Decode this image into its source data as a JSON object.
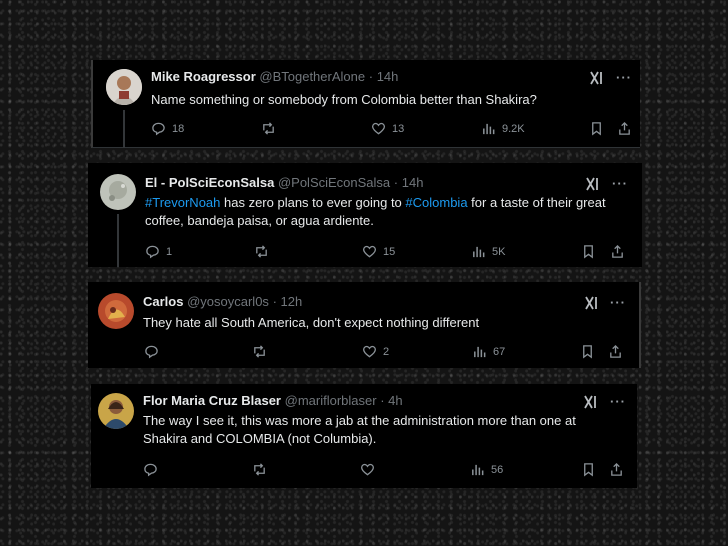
{
  "tweets": [
    {
      "name": "Mike Roagressor",
      "handle": "@BTogetherAlone",
      "separator": "·",
      "time": "14h",
      "text": "Name something or somebody from Colombia better than Shakira?",
      "stats": {
        "replies": "18",
        "reposts": "",
        "likes": "13",
        "views": "9.2K"
      },
      "avatar_color": "#c9c3bd"
    },
    {
      "name": "El - PolSciEconSalsa",
      "handle": "@PolSciEconSalsa",
      "separator": "·",
      "time": "14h",
      "text_parts": [
        "#TrevorNoah",
        " has zero plans to ever going to ",
        "#Colombia",
        " for a taste of their great coffee, bandeja paisa, or agua ardiente."
      ],
      "stats": {
        "replies": "1",
        "reposts": "",
        "likes": "15",
        "views": "5K"
      },
      "avatar_color": "#b9bdb4"
    },
    {
      "name": "Carlos",
      "handle": "@yosoycarl0s",
      "separator": "·",
      "time": "12h",
      "text": "They hate all South America, don't expect nothing different",
      "stats": {
        "replies": "",
        "reposts": "",
        "likes": "2",
        "views": "67"
      },
      "avatar_color": "#b5442a"
    },
    {
      "name": "Flor Maria Cruz Blaser",
      "handle": "@mariflorblaser",
      "separator": "·",
      "time": "4h",
      "text": "The way I see it, this was more a jab at the administration more than one at Shakira and COLOMBIA (not Columbia).",
      "stats": {
        "replies": "",
        "reposts": "",
        "likes": "",
        "views": "56"
      },
      "avatar_color": "#c9a548"
    }
  ],
  "ui": {
    "more_glyph": "···",
    "link_color": "#1d9bf0",
    "icons": [
      "reply-icon",
      "repost-icon",
      "like-icon",
      "views-icon",
      "bookmark-icon",
      "share-icon",
      "grok-icon",
      "more-icon"
    ]
  }
}
